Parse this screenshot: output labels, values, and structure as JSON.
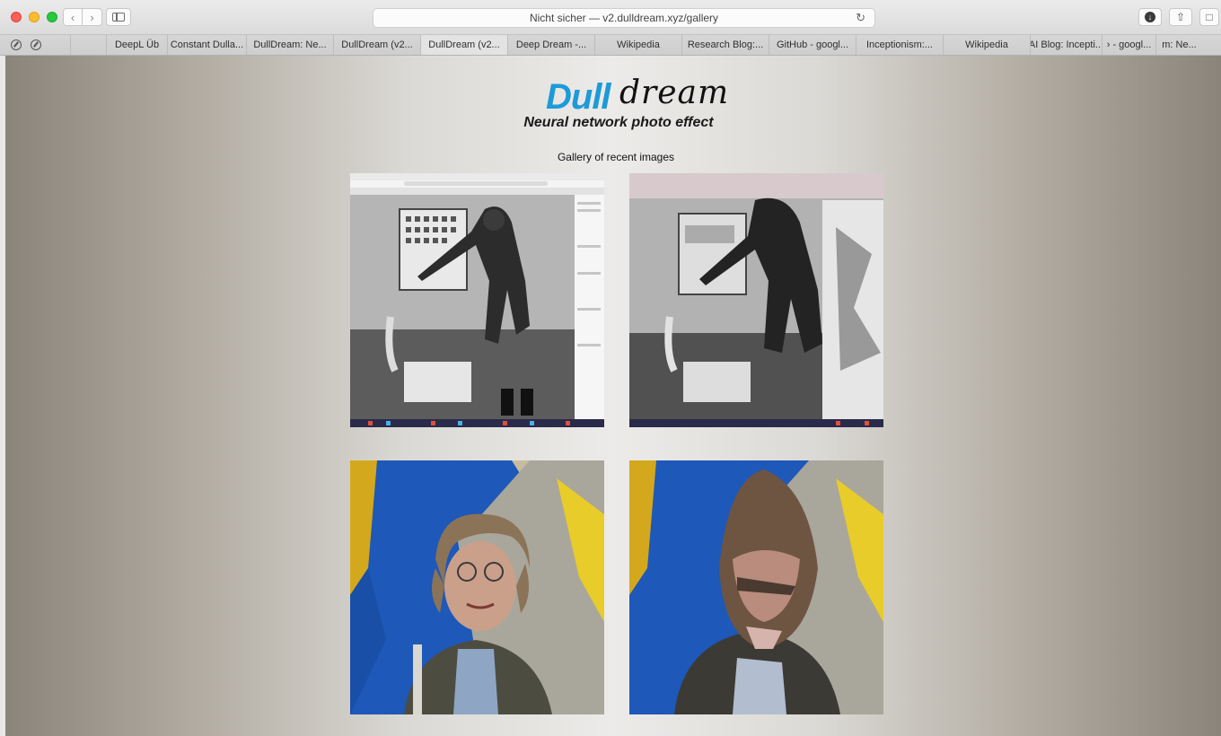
{
  "browser": {
    "url": "Nicht sicher — v2.dulldream.xyz/gallery",
    "tabs": [
      "DeepL Üb",
      "Constant Dulla...",
      "DullDream: Ne...",
      "DullDream (v2...",
      "DullDream (v2...",
      "Deep Dream -...",
      "Wikipedia",
      "Research Blog:...",
      "GitHub - googl...",
      "Inceptionism:...",
      "Wikipedia",
      "AI Blog: Incepti...",
      "› - googl...",
      "m: Ne..."
    ],
    "active_tab_index": 4
  },
  "page": {
    "logo_dull": "Dull",
    "logo_dream": "dream",
    "tagline": "Neural network photo effect",
    "gallery_heading": "Gallery of recent images"
  },
  "gallery": [
    {
      "kind": "original",
      "subject": "black-and-white photo of man in gallery (screenshot)"
    },
    {
      "kind": "dulled",
      "subject": "neural-network altered version"
    },
    {
      "kind": "original",
      "subject": "portrait of man with glasses in front of blue/yellow wall"
    },
    {
      "kind": "dulled",
      "subject": "neural-network altered portrait"
    }
  ],
  "colors": {
    "accent": "#1d9ad8",
    "traffic_red": "#fc5f57",
    "traffic_yellow": "#fdbc2e",
    "traffic_green": "#28c840"
  }
}
